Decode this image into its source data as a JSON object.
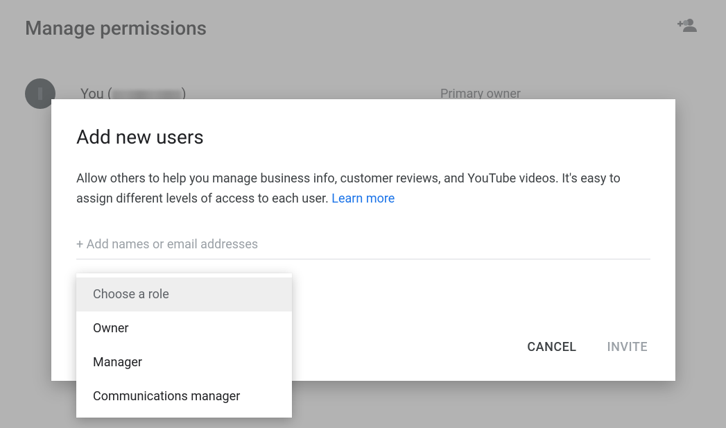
{
  "page": {
    "title": "Manage permissions",
    "user": {
      "name_prefix": "You (",
      "name_suffix": ")",
      "role": "Primary owner"
    }
  },
  "dialog": {
    "title": "Add new users",
    "description_1": "Allow others to help you manage business info, customer reviews, and YouTube videos. It's easy to assign different levels of access to each user. ",
    "learn_more": "Learn more",
    "input_placeholder": "+ Add names or email addresses",
    "cancel": "CANCEL",
    "invite": "INVITE"
  },
  "dropdown": {
    "placeholder": "Choose a role",
    "options": [
      "Owner",
      "Manager",
      "Communications manager"
    ]
  }
}
